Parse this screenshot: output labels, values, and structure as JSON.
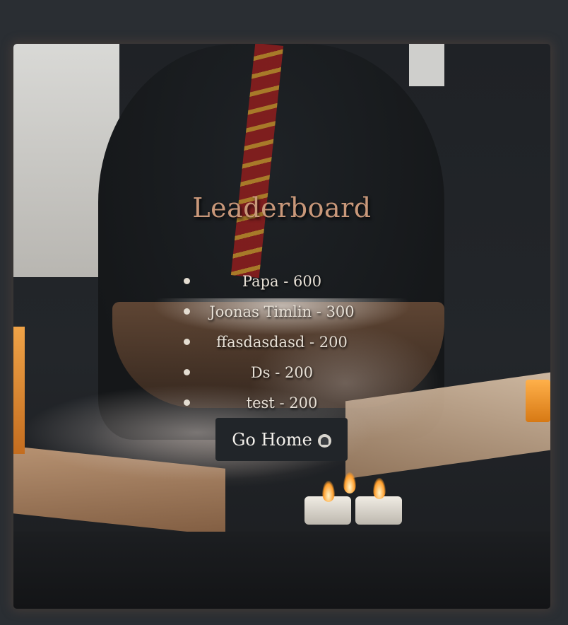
{
  "page": {
    "title": "Leaderboard"
  },
  "leaderboard": {
    "entries": [
      {
        "text": "Papa - 600"
      },
      {
        "text": "Joonas Timlin - 300"
      },
      {
        "text": "ffasdasdasd - 200"
      },
      {
        "text": "Ds - 200"
      },
      {
        "text": "test - 200"
      }
    ]
  },
  "actions": {
    "home_label": "Go Home",
    "home_icon": "wizard-face-icon"
  },
  "colors": {
    "page_bg": "#2a2e33",
    "title": "#c9987a",
    "button_bg": "#212529",
    "button_text": "#f4f1ec"
  }
}
